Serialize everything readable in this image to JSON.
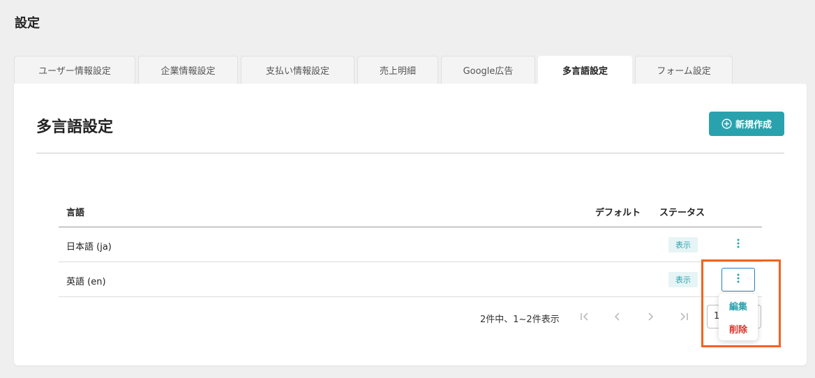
{
  "page": {
    "title": "設定"
  },
  "tabs": [
    {
      "label": "ユーザー情報設定",
      "active": false
    },
    {
      "label": "企業情報設定",
      "active": false
    },
    {
      "label": "支払い情報設定",
      "active": false
    },
    {
      "label": "売上明細",
      "active": false
    },
    {
      "label": "Google広告",
      "active": false
    },
    {
      "label": "多言語設定",
      "active": true
    },
    {
      "label": "フォーム設定",
      "active": false
    }
  ],
  "card": {
    "title": "多言語設定",
    "new_button_label": "新規作成"
  },
  "table": {
    "headers": {
      "language": "言語",
      "default": "デフォルト",
      "status": "ステータス"
    },
    "rows": [
      {
        "language": "日本語 (ja)",
        "status": "表示"
      },
      {
        "language": "英語 (en)",
        "status": "表示"
      }
    ]
  },
  "pagination": {
    "range_text": "2件中、1~2件表示",
    "page_size": "1"
  },
  "row_menu": {
    "edit_label": "編集",
    "delete_label": "削除"
  },
  "colors": {
    "accent": "#2aa2ad",
    "danger": "#d9342b",
    "highlight": "#f0641e"
  },
  "icons": {
    "new_button": "plus-circle-icon",
    "row_menu": "kebab-menu-icon",
    "pager": [
      "first-page-icon",
      "prev-page-icon",
      "next-page-icon",
      "last-page-icon"
    ]
  }
}
